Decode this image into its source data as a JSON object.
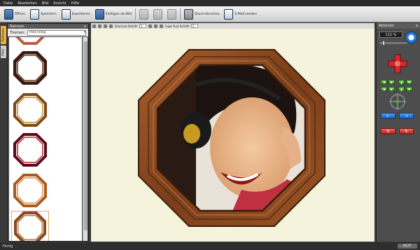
{
  "menu": [
    "Datei",
    "Bearbeiten",
    "Bild",
    "Ansicht",
    "Hilfe"
  ],
  "toolbar": {
    "open": "Öffnen",
    "save": "Speichern",
    "export": "Exportieren",
    "paste": "Einfügen als Bild",
    "print": "Druck-Vorschau",
    "email": "E-Mail senden"
  },
  "left_panel": {
    "title": "Rahmen",
    "close": "x",
    "theme_label": "Themen:",
    "theme_value": "Holz eckig",
    "tabs": [
      "Rahmen",
      "Filter"
    ]
  },
  "canvas_toolbar": {
    "rotate_label": "Grad pro Schritt",
    "rotate_value": "5",
    "zoom_label": "Lupe % je Schritt",
    "zoom_value": "5"
  },
  "right_panel": {
    "title": "Aktionen",
    "close": "x",
    "zoom": "122 %",
    "zoom_slider": 0.1
  },
  "status": {
    "left": "Fertig",
    "brand": "NEXT"
  },
  "colors": {
    "frame_wood": "#8a4a22",
    "canvas_bg": "#f6f3dc",
    "accent_red": "#d8262a",
    "accent_green": "#4cb52c",
    "accent_blue": "#2a7ad8"
  }
}
